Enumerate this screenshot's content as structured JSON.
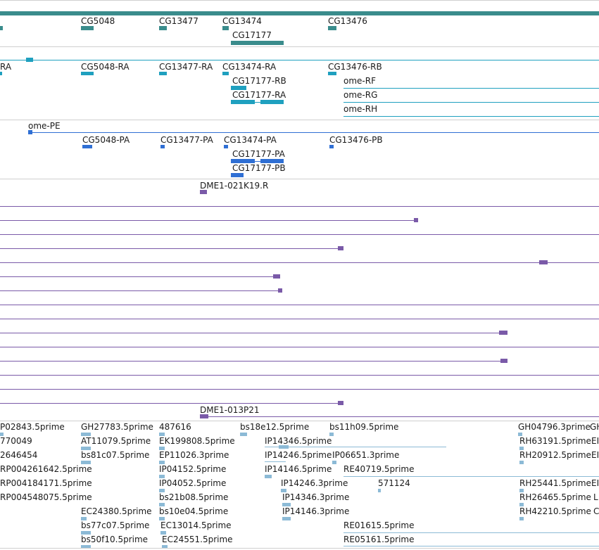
{
  "palette": {
    "scaffold": "#3a8c8c",
    "transcript": "#1fa0bf",
    "protein": "#2f6fd4",
    "clone": "#7a5aa8",
    "est": "#8cbad6",
    "separator": "#cfcfcf"
  },
  "tracks": {
    "gene": {
      "labels": [
        {
          "id": "g1",
          "text": "CG5048"
        },
        {
          "id": "g2",
          "text": "CG13477"
        },
        {
          "id": "g3",
          "text": "CG13474"
        },
        {
          "id": "g4",
          "text": "CG13476"
        },
        {
          "id": "g5",
          "text": "CG17177"
        }
      ]
    },
    "transcript": {
      "labels": [
        {
          "id": "t0",
          "text": "RA"
        },
        {
          "id": "t1",
          "text": "CG5048-RA"
        },
        {
          "id": "t2",
          "text": "CG13477-RA"
        },
        {
          "id": "t3",
          "text": "CG13474-RA"
        },
        {
          "id": "t4",
          "text": "CG13476-RB"
        },
        {
          "id": "t5",
          "text": "CG17177-RB"
        },
        {
          "id": "t6",
          "text": "ome-RF"
        },
        {
          "id": "t7",
          "text": "CG17177-RA"
        },
        {
          "id": "t8",
          "text": "ome-RG"
        },
        {
          "id": "t9",
          "text": "ome-RH"
        }
      ]
    },
    "protein": {
      "labels": [
        {
          "id": "p0",
          "text": "ome-PE"
        },
        {
          "id": "p1",
          "text": "CG5048-PA"
        },
        {
          "id": "p2",
          "text": "CG13477-PA"
        },
        {
          "id": "p3",
          "text": "CG13474-PA"
        },
        {
          "id": "p4",
          "text": "CG13476-PB"
        },
        {
          "id": "p5",
          "text": "CG17177-PA"
        },
        {
          "id": "p6",
          "text": "CG17177-PB"
        }
      ]
    },
    "clone": {
      "labels": [
        {
          "id": "c1",
          "text": "DME1-021K19.R"
        },
        {
          "id": "c2",
          "text": "DME1-013P21"
        }
      ]
    },
    "est": {
      "labels": [
        {
          "id": "e1",
          "text": "P02843.5prime"
        },
        {
          "id": "e2",
          "text": "GH27783.5prime"
        },
        {
          "id": "e3",
          "text": "487616"
        },
        {
          "id": "e4",
          "text": "bs18e12.5prime"
        },
        {
          "id": "e5",
          "text": "bs11h09.5prime"
        },
        {
          "id": "e6",
          "text": "GH04796.3prime"
        },
        {
          "id": "e6b",
          "text": "GH"
        },
        {
          "id": "e7",
          "text": "770049"
        },
        {
          "id": "e8",
          "text": "AT11079.5prime"
        },
        {
          "id": "e9",
          "text": "EK199808.5prime"
        },
        {
          "id": "e10",
          "text": "IP14346.5prime"
        },
        {
          "id": "e11",
          "text": "RH63191.5prime"
        },
        {
          "id": "e11b",
          "text": "EI"
        },
        {
          "id": "e12",
          "text": "2646454"
        },
        {
          "id": "e13",
          "text": "bs81c07.5prime"
        },
        {
          "id": "e14",
          "text": "EP11026.3prime"
        },
        {
          "id": "e15",
          "text": "IP14246.5prime"
        },
        {
          "id": "e16",
          "text": "IP06651.3prime"
        },
        {
          "id": "e17",
          "text": "RH20912.5prime"
        },
        {
          "id": "e17b",
          "text": "EI"
        },
        {
          "id": "e18",
          "text": "RP004261642.5prime"
        },
        {
          "id": "e19",
          "text": "IP04152.5prime"
        },
        {
          "id": "e20",
          "text": "IP14146.5prime"
        },
        {
          "id": "e21",
          "text": "RE40719.5prime"
        },
        {
          "id": "e22",
          "text": "RP004184171.5prime"
        },
        {
          "id": "e23",
          "text": "IP04052.5prime"
        },
        {
          "id": "e24",
          "text": "IP14246.3prime"
        },
        {
          "id": "e25",
          "text": "571124"
        },
        {
          "id": "e26",
          "text": "RH25441.5prime"
        },
        {
          "id": "e26b",
          "text": "EI"
        },
        {
          "id": "e27",
          "text": "RP004548075.5prime"
        },
        {
          "id": "e28",
          "text": "bs21b08.5prime"
        },
        {
          "id": "e29",
          "text": "IP14346.3prime"
        },
        {
          "id": "e30",
          "text": "RH26465.5prime"
        },
        {
          "id": "e30b",
          "text": "L"
        },
        {
          "id": "e31",
          "text": "EC24380.5prime"
        },
        {
          "id": "e32",
          "text": "bs10e04.5prime"
        },
        {
          "id": "e33",
          "text": "IP14146.3prime"
        },
        {
          "id": "e34",
          "text": "RH42210.5prime"
        },
        {
          "id": "e34b",
          "text": "C"
        },
        {
          "id": "e35",
          "text": "bs77c07.5prime"
        },
        {
          "id": "e36",
          "text": "EC13014.5prime"
        },
        {
          "id": "e37",
          "text": "RE01615.5prime"
        },
        {
          "id": "e38",
          "text": "bs50f10.5prime"
        },
        {
          "id": "e39",
          "text": "EC24551.5prime"
        },
        {
          "id": "e40",
          "text": "RE05161.5prime"
        }
      ]
    }
  }
}
